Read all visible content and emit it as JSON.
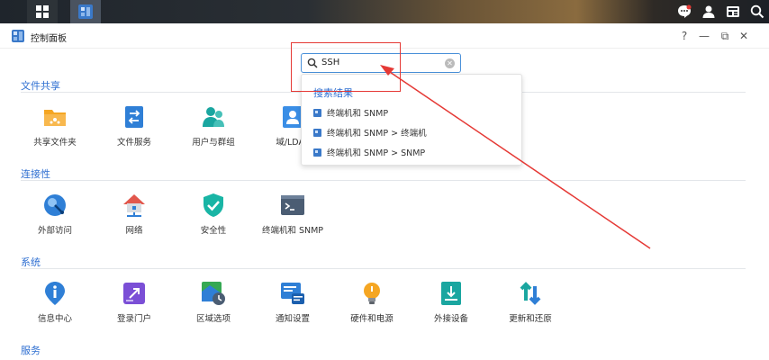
{
  "taskbar": {
    "icons": [
      "main-menu-icon",
      "control-panel-icon",
      "chat-icon",
      "user-icon",
      "widgets-icon",
      "search-icon"
    ]
  },
  "window": {
    "title": "控制面板",
    "controls": [
      "?",
      "—",
      "⧉",
      "✕"
    ]
  },
  "search": {
    "value": "SSH",
    "results_title": "搜索结果",
    "results": [
      "终端机和 SNMP",
      "终端机和 SNMP > 终端机",
      "终端机和 SNMP > SNMP"
    ]
  },
  "annotation": {
    "color": "#e53935"
  },
  "sections": {
    "file_sharing": {
      "title": "文件共享",
      "items": [
        {
          "label": "共享文件夹",
          "icon": "shared-folder-icon"
        },
        {
          "label": "文件服务",
          "icon": "file-services-icon"
        },
        {
          "label": "用户与群组",
          "icon": "users-groups-icon"
        },
        {
          "label": "域/LDAP",
          "icon": "domain-ldap-icon"
        }
      ]
    },
    "connectivity": {
      "title": "连接性",
      "items": [
        {
          "label": "外部访问",
          "icon": "external-access-icon"
        },
        {
          "label": "网络",
          "icon": "network-icon"
        },
        {
          "label": "安全性",
          "icon": "security-icon"
        },
        {
          "label": "终端机和 SNMP",
          "icon": "terminal-icon"
        }
      ]
    },
    "system": {
      "title": "系统",
      "items": [
        {
          "label": "信息中心",
          "icon": "info-center-icon"
        },
        {
          "label": "登录门户",
          "icon": "login-portal-icon"
        },
        {
          "label": "区域选项",
          "icon": "regional-options-icon"
        },
        {
          "label": "通知设置",
          "icon": "notification-icon"
        },
        {
          "label": "硬件和电源",
          "icon": "hardware-power-icon"
        },
        {
          "label": "外接设备",
          "icon": "external-devices-icon"
        },
        {
          "label": "更新和还原",
          "icon": "update-restore-icon"
        }
      ]
    },
    "services": {
      "title": "服务"
    }
  },
  "colors": {
    "accent": "#2f6fd1",
    "search_border": "#4a90d9"
  }
}
